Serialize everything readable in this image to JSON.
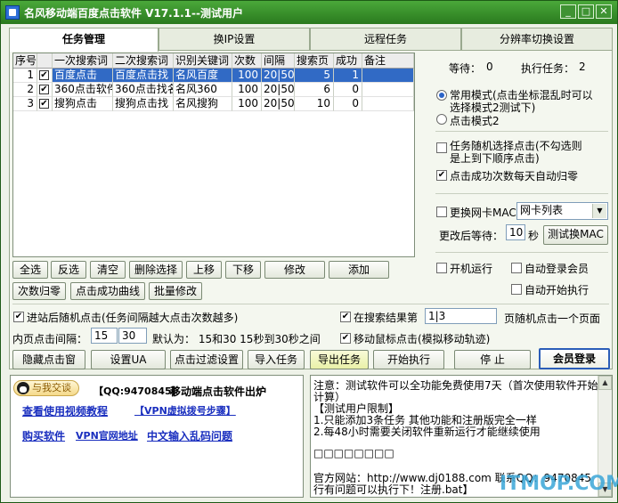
{
  "window": {
    "title": "名风移动端百度点击软件 V17.1.1--测试用户",
    "minimize": "_",
    "maximize": "□",
    "close": "✕"
  },
  "tabs": [
    {
      "label": "任务管理",
      "active": true
    },
    {
      "label": "换IP设置",
      "active": false
    },
    {
      "label": "远程任务",
      "active": false
    },
    {
      "label": "分辨率切换设置",
      "active": false
    }
  ],
  "task_table": {
    "columns": [
      "序号",
      "一次搜索词",
      "二次搜索词",
      "识别关键词",
      "次数",
      "间隔",
      "搜索页",
      "成功",
      "备注"
    ],
    "rows": [
      {
        "index": "1",
        "checked": "✔",
        "first": "百度点击",
        "second": "百度点击找",
        "keyword": "名风百度",
        "count": "100",
        "interval": "20|50",
        "page": "5",
        "success": "1",
        "note": "",
        "selected": true
      },
      {
        "index": "2",
        "checked": "✔",
        "first": "360点击软件",
        "second": "360点击找名",
        "keyword": "名风360",
        "count": "100",
        "interval": "20|50",
        "page": "6",
        "success": "0",
        "note": "",
        "selected": false
      },
      {
        "index": "3",
        "checked": "✔",
        "first": "搜狗点击",
        "second": "搜狗点击找",
        "keyword": "名风搜狗",
        "count": "100",
        "interval": "20|50",
        "page": "10",
        "success": "0",
        "note": "",
        "selected": false
      }
    ]
  },
  "status": {
    "waiting_label": "等待：",
    "waiting_value": "0",
    "running_label": "执行任务：",
    "running_value": "2"
  },
  "modes": {
    "common_line1": "常用模式(点击坐标混乱时可以",
    "common_line2": "选择模式2测试下)",
    "mode2": "点击模式2"
  },
  "options": {
    "random_line1": "任务随机选择点击(不勾选则",
    "random_line2": "是上到下顺序点击)",
    "auto_reset": "点击成功次数每天自动归零",
    "mac_change": "更换网卡MAC",
    "nic_select": "网卡列表",
    "after_change_wait": "更改后等待：",
    "wait_seconds": "10",
    "seconds_unit": "秒",
    "test_mac": "测试换MAC",
    "boot_run": "开机运行",
    "auto_login": "自动登录会员",
    "auto_start": "自动开始执行"
  },
  "task_buttons": {
    "select_all": "全选",
    "invert": "反选",
    "clear": "清空",
    "delete_selected": "删除选择",
    "move_up": "上移",
    "move_down": "下移",
    "modify": "修改",
    "add": "添加",
    "reset_count": "次数归零",
    "success_curve": "点击成功曲线",
    "batch_modify": "批量修改"
  },
  "settings": {
    "random_click": "进站后随机点击(任务间隔越大点击次数越多)",
    "in_results": "在搜索结果第",
    "page_range": "1|3",
    "random_one": "页随机点击一个页面",
    "inner_interval": "内页点击间隔：",
    "interval_min": "15",
    "interval_max": "30",
    "default_text": "默认为： 15和30  15秒到30秒之间",
    "mouse_move": "移动鼠标点击(模拟移动轨迹)"
  },
  "action_buttons": {
    "hide_click": "隐藏点击窗",
    "set_ua": "设置UA",
    "click_filter": "点击过滤设置",
    "import": "导入任务",
    "export": "导出任务",
    "start": "开始执行",
    "stop": "停 止",
    "login": "会员登录"
  },
  "promo": {
    "chat_badge": "与我交谈",
    "qq": "【QQ:9470845】",
    "headline": "移动端点击软件出炉",
    "video_tutorial": "查看使用视频教程",
    "vpn_steps": "【VPN虚拟拨号步骤】",
    "buy": "购买软件",
    "vpn_site": "VPN官网地址",
    "input_garbled": "中文输入乱码问题"
  },
  "notes": [
    "注意：测试软件可以全功能免费使用7天（首次使用软件开始",
    "计算）",
    "【测试用户限制】",
    "1.只能添加3条任务 其他功能和注册版完全一样",
    "2.每48小时需要关闭软件重新运行才能继续使用",
    "",
    "□□□□□□□□",
    "",
    "官方网站：http://www.dj0188.com 联系QQ：9470845  【运",
    "行有问题可以执行下！注册.bat】"
  ],
  "watermark": "ITMOP.COM"
}
